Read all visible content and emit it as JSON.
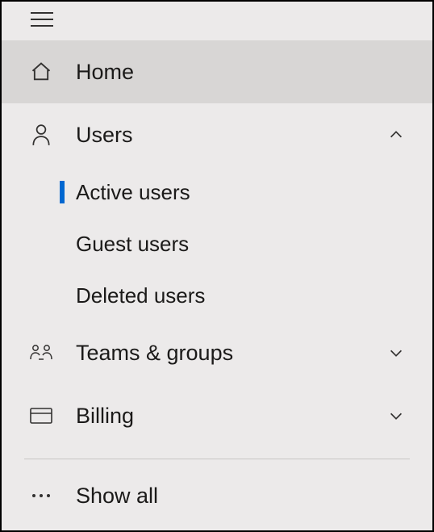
{
  "nav": {
    "home": "Home",
    "users": {
      "label": "Users",
      "children": {
        "active": "Active users",
        "guest": "Guest users",
        "deleted": "Deleted users"
      }
    },
    "teams": "Teams & groups",
    "billing": "Billing",
    "showAll": "Show all"
  }
}
